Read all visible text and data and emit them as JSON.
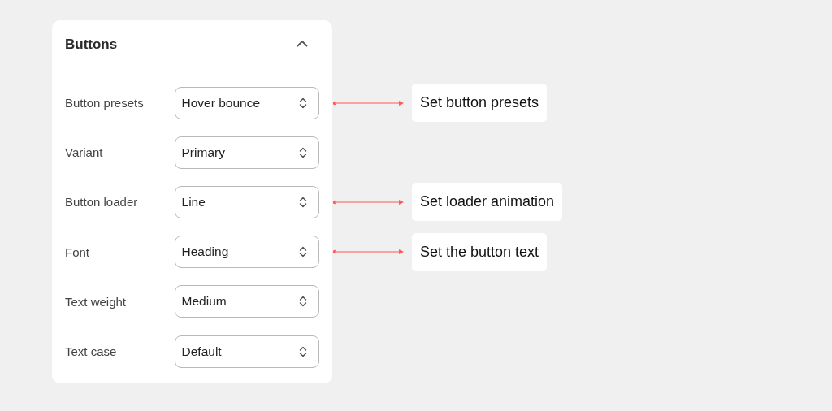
{
  "panel": {
    "title": "Buttons",
    "expanded": true,
    "rows": [
      {
        "label": "Button presets",
        "value": "Hover bounce",
        "annotation": "Set button presets"
      },
      {
        "label": "Variant",
        "value": "Primary"
      },
      {
        "label": "Button loader",
        "value": "Line",
        "annotation": "Set loader animation"
      },
      {
        "label": "Font",
        "value": "Heading",
        "annotation": "Set the button text"
      },
      {
        "label": "Text weight",
        "value": "Medium"
      },
      {
        "label": "Text case",
        "value": "Default"
      }
    ]
  }
}
